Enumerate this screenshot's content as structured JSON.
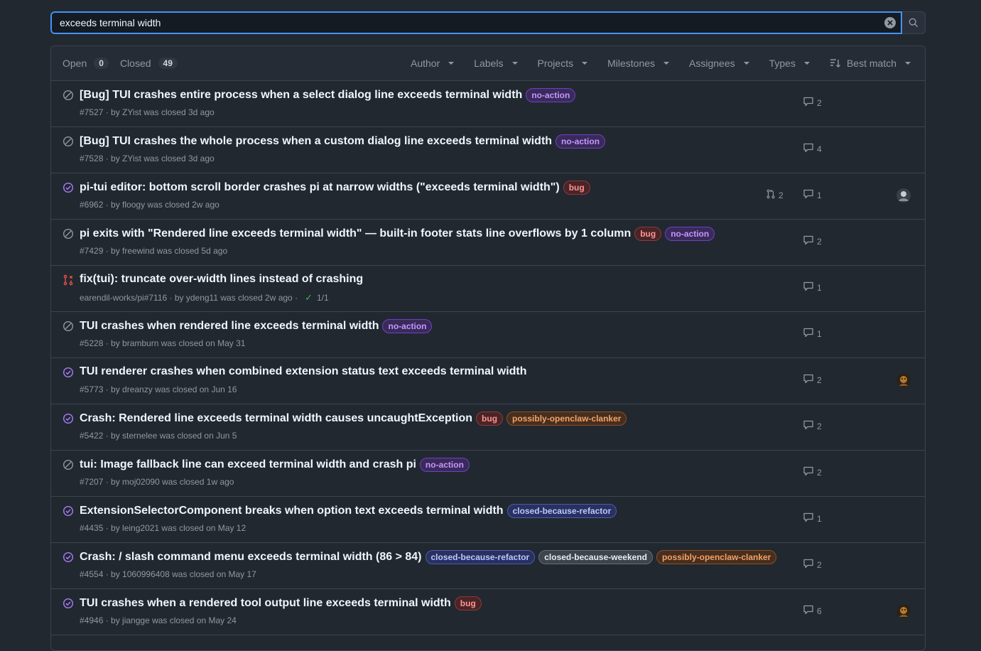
{
  "search": {
    "query": "exceeds terminal width"
  },
  "tabs": {
    "open_label": "Open",
    "open_count": "0",
    "closed_label": "Closed",
    "closed_count": "49"
  },
  "filters": [
    "Author",
    "Labels",
    "Projects",
    "Milestones",
    "Assignees",
    "Types"
  ],
  "sort": {
    "label": "Best match"
  },
  "colors": {
    "accent": "#4493f8",
    "closed_purple": "#ab7df8",
    "not_planned_gray": "#9198a1",
    "pr_closed_red": "#f85149"
  },
  "issues": [
    {
      "state": "not-planned",
      "title": "[Bug] TUI crashes entire process when a select dialog line exceeds terminal width",
      "labels": [
        {
          "text": "no-action",
          "kind": "no-action"
        }
      ],
      "meta": "#7527 · by ZYist was closed 3d ago",
      "comments": "2",
      "linked_prs": "",
      "avatar": ""
    },
    {
      "state": "not-planned",
      "title": "[Bug] TUI crashes the whole process when a custom dialog line exceeds terminal width",
      "labels": [
        {
          "text": "no-action",
          "kind": "no-action"
        }
      ],
      "meta": "#7528 · by ZYist was closed 3d ago",
      "comments": "4",
      "linked_prs": "",
      "avatar": ""
    },
    {
      "state": "completed",
      "title": "pi-tui editor: bottom scroll border crashes pi at narrow widths (\"exceeds terminal width\")",
      "labels": [
        {
          "text": "bug",
          "kind": "bug"
        }
      ],
      "meta": "#6962 · by floogy was closed 2w ago",
      "comments": "1",
      "linked_prs": "2",
      "avatar": "gray"
    },
    {
      "state": "not-planned",
      "title": "pi exits with \"Rendered line exceeds terminal width\" — built-in footer stats line overflows by 1 column",
      "labels": [
        {
          "text": "bug",
          "kind": "bug"
        },
        {
          "text": "no-action",
          "kind": "no-action"
        }
      ],
      "meta": "#7429 · by freewind was closed 5d ago",
      "comments": "2",
      "linked_prs": "",
      "avatar": ""
    },
    {
      "state": "pr-closed",
      "title": "fix(tui): truncate over-width lines instead of crashing",
      "labels": [],
      "meta": "earendil-works/pi#7116 · by ydeng11 was closed 2w ago ·",
      "checks": "1/1",
      "comments": "1",
      "linked_prs": "",
      "avatar": ""
    },
    {
      "state": "not-planned",
      "title": "TUI crashes when rendered line exceeds terminal width",
      "labels": [
        {
          "text": "no-action",
          "kind": "no-action"
        }
      ],
      "meta": "#5228 · by bramburn was closed on May 31",
      "comments": "1",
      "linked_prs": "",
      "avatar": ""
    },
    {
      "state": "completed",
      "title": "TUI renderer crashes when combined extension status text exceeds terminal width",
      "labels": [],
      "meta": "#5773 · by dreanzy was closed on Jun 16",
      "comments": "2",
      "linked_prs": "",
      "avatar": "brown"
    },
    {
      "state": "completed",
      "title": "Crash: Rendered line exceeds terminal width causes uncaughtException",
      "labels": [
        {
          "text": "bug",
          "kind": "bug"
        },
        {
          "text": "possibly-openclaw-clanker",
          "kind": "opc"
        }
      ],
      "meta": "#5422 · by sternelee was closed on Jun 5",
      "comments": "2",
      "linked_prs": "",
      "avatar": ""
    },
    {
      "state": "not-planned",
      "title": "tui: Image fallback line can exceed terminal width and crash pi",
      "labels": [
        {
          "text": "no-action",
          "kind": "no-action"
        }
      ],
      "meta": "#7207 · by moj02090 was closed 1w ago",
      "comments": "2",
      "linked_prs": "",
      "avatar": ""
    },
    {
      "state": "completed",
      "title": "ExtensionSelectorComponent breaks when option text exceeds terminal width",
      "labels": [
        {
          "text": "closed-because-refactor",
          "kind": "cbr"
        }
      ],
      "meta": "#4435 · by leing2021 was closed on May 12",
      "comments": "1",
      "linked_prs": "",
      "avatar": ""
    },
    {
      "state": "completed",
      "title": "Crash: / slash command menu exceeds terminal width (86 > 84)",
      "labels": [
        {
          "text": "closed-because-refactor",
          "kind": "cbr"
        },
        {
          "text": "closed-because-weekend",
          "kind": "cbw"
        },
        {
          "text": "possibly-openclaw-clanker",
          "kind": "opc"
        }
      ],
      "meta": "#4554 · by 1060996408 was closed on May 17",
      "comments": "2",
      "linked_prs": "",
      "avatar": ""
    },
    {
      "state": "completed",
      "title": "TUI crashes when a rendered tool output line exceeds terminal width",
      "labels": [
        {
          "text": "bug",
          "kind": "bug"
        }
      ],
      "meta": "#4946 · by jiangge was closed on May 24",
      "comments": "6",
      "linked_prs": "",
      "avatar": "brown"
    }
  ]
}
